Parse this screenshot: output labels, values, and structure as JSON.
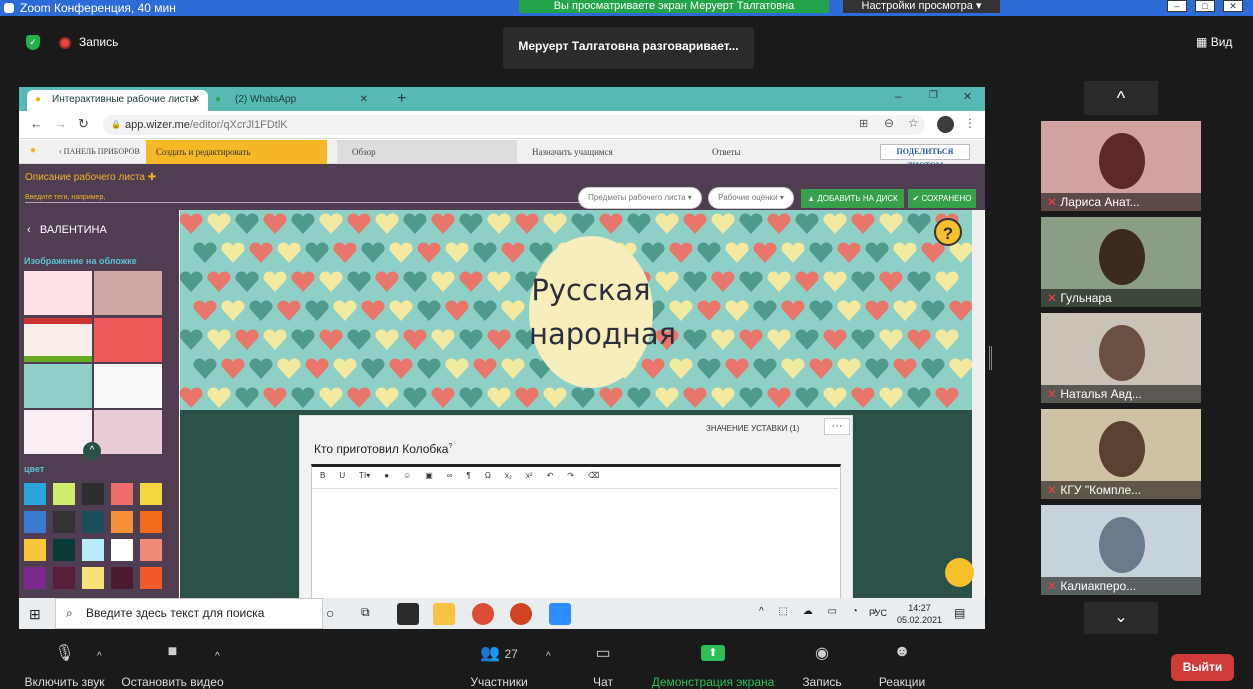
{
  "zoom": {
    "window_title": "Zoom Конференция, 40 мин",
    "share_banner": "Вы просматриваете экран Меруерт Талгатовна",
    "view_settings": "Настройки просмотра",
    "record_label": "Запись",
    "speaking": "Меруерт Талгатовна разговаривает...",
    "view_label": "Вид"
  },
  "browser": {
    "tabs": [
      {
        "label": "Интерактивные рабочие листы",
        "icon": "bulb-icon"
      },
      {
        "label": "(2) WhatsApp",
        "icon": "whatsapp-icon"
      }
    ],
    "url_domain": "app.wizer.me",
    "url_path": "/editor/qXcrJl1FDtlK"
  },
  "wizer": {
    "steps": {
      "dashboard": "ПАНЕЛЬ ПРИБОРОВ",
      "create": "Создать и редактировать",
      "overview": "Обзор",
      "assign": "Назначить учащимся",
      "answers": "Ответы"
    },
    "share_button": "ПОДЕЛИТЬСЯ ЛИСТОМ",
    "description_label": "Описание рабочего листа",
    "tags_placeholder": "Введите теги, например,",
    "subjects_select": "Предметы рабочего листа",
    "grades_select": "Рабочие оценки",
    "add_drive": "ДОБАВИТЬ НА ДИСК",
    "saved": "СОХРАНЕНО",
    "sidebar": {
      "user": "ВАЛЕНТИНА",
      "cover_image": "Изображение на обложке",
      "color": "цвет",
      "swatches": [
        "#29a6d9",
        "#d1ec6c",
        "#2e2e2e",
        "#ee6d6d",
        "#f5d743",
        "#3b7bd1",
        "#333333",
        "#1c4e5a",
        "#f6903a",
        "#f36b1a",
        "#f5c93b",
        "#0c3b33",
        "#b8ecf7",
        "#ffffff",
        "#f08a7a",
        "#7a2a8a",
        "#5a1f38",
        "#f6e27a",
        "#4a1a30",
        "#f05a2a"
      ]
    },
    "cover_title_line1": "Русская",
    "cover_title_line2": "народная",
    "snap_value": "ЗНАЧЕНИЕ УСТАВКИ (1)",
    "more": "···",
    "question": "Кто приготовил Колобка",
    "question_sup": "?",
    "help": "?"
  },
  "taskbar": {
    "search": "Введите здесь текст для поиска",
    "lang": "РУС",
    "time": "14:27",
    "date": "05.02.2021"
  },
  "participants": [
    {
      "name": "Лариса Анат..."
    },
    {
      "name": "Гульнара"
    },
    {
      "name": "Наталья Авд..."
    },
    {
      "name": "КГУ \"Компле..."
    },
    {
      "name": "Калиакперо..."
    }
  ],
  "controls": {
    "mute": "Включить звук",
    "video": "Остановить видео",
    "participants_count": "27",
    "participants": "Участники",
    "chat": "Чат",
    "share": "Демонстрация экрана",
    "record": "Запись",
    "reactions": "Реакции",
    "leave": "Выйти"
  }
}
